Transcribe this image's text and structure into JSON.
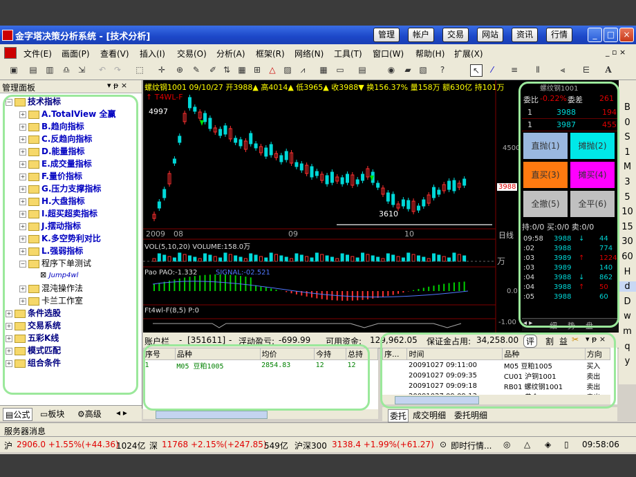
{
  "window": {
    "title": "金字塔决策分析系统 - [技术分析]",
    "nav_buttons": [
      "管理",
      "帐户",
      "交易",
      "网站",
      "资讯",
      "行情"
    ],
    "controls": [
      "_",
      "□",
      "×"
    ]
  },
  "menu": {
    "items": [
      "文件(E)",
      "画面(P)",
      "查看(V)",
      "插入(I)",
      "交易(O)",
      "分析(A)",
      "框架(R)",
      "网络(N)",
      "工具(T)",
      "窗口(W)",
      "帮助(H)",
      "扩展(X)"
    ]
  },
  "left_panel": {
    "title": "管理面板",
    "tree": [
      {
        "label": "技术指标",
        "level": 0,
        "expanded": true
      },
      {
        "label": "A.TotalView 全赢",
        "level": 1
      },
      {
        "label": "B.趋向指标",
        "level": 1
      },
      {
        "label": "C.反趋向指标",
        "level": 1
      },
      {
        "label": "D.能量指标",
        "level": 1
      },
      {
        "label": "E.成交量指标",
        "level": 1
      },
      {
        "label": "F.量价指标",
        "level": 1
      },
      {
        "label": "G.压力支撑指标",
        "level": 1
      },
      {
        "label": "H.大盘指标",
        "level": 1
      },
      {
        "label": "I.超买超卖指标",
        "level": 1
      },
      {
        "label": "J.摆动指标",
        "level": 1
      },
      {
        "label": "K.多空势利对比",
        "level": 1
      },
      {
        "label": "L.强弱指标",
        "level": 1
      },
      {
        "label": "程序下单测试",
        "level": 1,
        "expanded": true
      },
      {
        "label": "Jump4wl",
        "level": 2
      },
      {
        "label": "混沌操作法",
        "level": 1
      },
      {
        "label": "卡兰工作室",
        "level": 1
      },
      {
        "label": "条件选股",
        "level": 0
      },
      {
        "label": "交易系统",
        "level": 0
      },
      {
        "label": "五彩K线",
        "level": 0
      },
      {
        "label": "模式匹配",
        "level": 0
      },
      {
        "label": "组合条件",
        "level": 0
      }
    ],
    "tabs": [
      "公式",
      "板块",
      "高级"
    ]
  },
  "chart": {
    "header": "螺纹钢1001 09/10/27 开3988▲ 高4014▲ 低3965▲ 收3988▼ 换156.37% 量158万 额630亿 持101万",
    "indicator_label": "T4WL-F",
    "high_label": "4997",
    "low_label": "3610",
    "price_right": "4500",
    "price_tag": "3988",
    "dates": [
      "2009",
      "08",
      "09",
      "10"
    ],
    "period": "日线",
    "vol_label": "VOL(5,10,20) VOLUME:158.0万",
    "vol_unit": "万",
    "pao_label": "Pao PAO:-1.332",
    "pao_signal": "SIGNAL:-02.521",
    "pao_right": "0.0",
    "ft_label": "Ft4wl-F(8,5) P:0",
    "ft_right": "-1.00"
  },
  "order_panel": {
    "header": "螺纹钢1001",
    "weibi": "委比",
    "weibi_val": "-0.22%",
    "weicha": "委差",
    "weicha_val": "261",
    "book": [
      {
        "lvl": "1",
        "price": "3988",
        "vol": "194"
      },
      {
        "lvl": "1",
        "price": "3987",
        "vol": "455"
      }
    ],
    "buttons": [
      {
        "label": "直抛(1)",
        "color": "#9ab8e0"
      },
      {
        "label": "摊抛(2)",
        "color": "#00e8e8"
      },
      {
        "label": "直买(3)",
        "color": "#ff7a10"
      },
      {
        "label": "摊买(4)",
        "color": "#ff00ff"
      },
      {
        "label": "全撤(5)",
        "color": "#c0c0c0"
      },
      {
        "label": "全平(6)",
        "color": "#c0c0c0"
      }
    ],
    "holdings": "持:0/0 买:0/0 卖:0/0",
    "trades": [
      {
        "time": "09:58",
        "price": "3988",
        "dir": "↓",
        "vol": "44"
      },
      {
        "time": ":02",
        "price": "3988",
        "dir": "",
        "vol": "774"
      },
      {
        "time": ":03",
        "price": "3989",
        "dir": "↑",
        "vol": "1224"
      },
      {
        "time": ":03",
        "price": "3989",
        "dir": "",
        "vol": "140"
      },
      {
        "time": ":04",
        "price": "3988",
        "dir": "↓",
        "vol": "862"
      },
      {
        "time": ":04",
        "price": "3988",
        "dir": "↑",
        "vol": "50"
      },
      {
        "time": ":05",
        "price": "3988",
        "dir": "",
        "vol": "60"
      }
    ],
    "tabs": [
      "细",
      "势",
      "盘"
    ]
  },
  "right_ticks": [
    "B",
    "0",
    "S",
    "1",
    "M",
    "3",
    "5",
    "10",
    "15",
    "30",
    "60",
    "H",
    "d",
    "D",
    "w",
    "m",
    "q",
    "y"
  ],
  "account": {
    "label": "账户栏",
    "account_id": "[351611]",
    "float_pl_label": "浮动盈亏:",
    "float_pl": "-699.99",
    "avail_label": "可用资金:",
    "avail": "129,962.05",
    "margin_label": "保证金占用:",
    "margin": "34,258.00",
    "btn_ping": "评",
    "btn_ge": "割",
    "btn_yi": "益"
  },
  "positions": {
    "columns": [
      "序号",
      "品种",
      "均价",
      "今持",
      "总持"
    ],
    "rows": [
      {
        "no": "1",
        "name": "M05 豆粕1005",
        "avg": "2854.83",
        "today": "12",
        "total": "12"
      }
    ]
  },
  "orders": {
    "columns": [
      "序...",
      "时间",
      "品种",
      "方向"
    ],
    "rows": [
      {
        "seq": "",
        "time": "20091027 09:11:00",
        "name": "M05 豆粕1005",
        "dir": "买入"
      },
      {
        "seq": "",
        "time": "20091027 09:09:35",
        "name": "CU01 沪铜1001",
        "dir": "卖出"
      },
      {
        "seq": "",
        "time": "20091027 09:09:18",
        "name": "RB01 螺纹钢1001",
        "dir": "卖出"
      },
      {
        "seq": "",
        "time": "20091027 09:09:13",
        "name": "AU06 黄金1006",
        "dir": "卖出"
      }
    ],
    "tabs": [
      "委托",
      "成交明细",
      "委托明细"
    ]
  },
  "server_msg": "服务器消息",
  "statusbar": {
    "sh_label": "沪",
    "sh": "2906.0 +1.55%(+44.36)",
    "sh_amt": "1024亿",
    "sz_label": "深",
    "sz": "11768 +2.15%(+247.85)",
    "sz_amt": "549亿",
    "hs_label": "沪深300",
    "hs": "3138.4 +1.99%(+61.27)",
    "realtime": "即时行情...",
    "time": "09:58:06"
  }
}
